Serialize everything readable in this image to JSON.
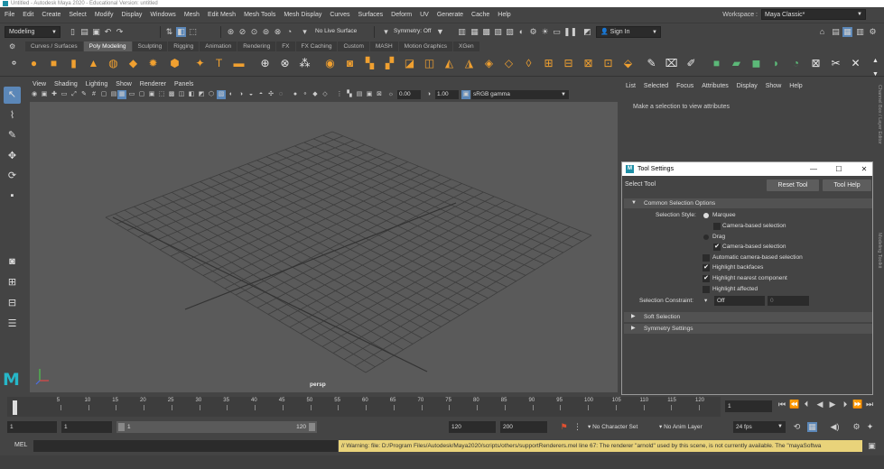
{
  "window": {
    "title": "Untitled - Autodesk Maya 2020 - Educational Version: untitled"
  },
  "menubar": {
    "items": [
      "File",
      "Edit",
      "Create",
      "Select",
      "Modify",
      "Display",
      "Windows",
      "Mesh",
      "Edit Mesh",
      "Mesh Tools",
      "Mesh Display",
      "Curves",
      "Surfaces",
      "Deform",
      "UV",
      "Generate",
      "Cache",
      "Help"
    ],
    "workspace_label": "Workspace :",
    "workspace_value": "Maya Classic*"
  },
  "statusline": {
    "mode": "Modeling",
    "live_surface": "No Live Surface",
    "symmetry": "Symmetry: Off",
    "sign_in": "Sign In"
  },
  "shelf_tabs": [
    "Curves / Surfaces",
    "Poly Modeling",
    "Sculpting",
    "Rigging",
    "Animation",
    "Rendering",
    "FX",
    "FX Caching",
    "Custom",
    "MASH",
    "Motion Graphics",
    "XGen"
  ],
  "shelf_active": "Poly Modeling",
  "viewport": {
    "menu": [
      "View",
      "Shading",
      "Lighting",
      "Show",
      "Renderer",
      "Panels"
    ],
    "exposure": "0.00",
    "gamma": "1.00",
    "color_space": "sRGB gamma",
    "camera_label": "persp"
  },
  "attribute_editor": {
    "menu": [
      "List",
      "Selected",
      "Focus",
      "Attributes",
      "Display",
      "Show",
      "Help"
    ],
    "message": "Make a selection to view attributes"
  },
  "right_strip": {
    "channel_box": "Channel Box / Layer Editor",
    "modeling_toolkit": "Modeling Toolkit"
  },
  "tool_settings": {
    "title": "Tool Settings",
    "tool_name": "Select Tool",
    "reset_button": "Reset Tool",
    "help_button": "Tool Help",
    "common_section": "Common Selection Options",
    "selection_style_label": "Selection Style:",
    "marquee": "Marquee",
    "camera_based_1": "Camera-based selection",
    "drag": "Drag",
    "camera_based_2": "Camera-based selection",
    "auto_camera": "Automatic camera-based selection",
    "highlight_backfaces": "Highlight backfaces",
    "highlight_nearest": "Highlight nearest component",
    "highlight_affected": "Highlight affected",
    "constraint_label": "Selection Constraint:",
    "constraint_value": "Off",
    "constraint_num": "0",
    "soft_selection": "Soft Selection",
    "symmetry_settings": "Symmetry Settings",
    "checks": {
      "camera_based_1": false,
      "camera_based_2": true,
      "auto_camera": false,
      "highlight_backfaces": true,
      "highlight_nearest": true,
      "highlight_affected": false
    }
  },
  "timeslider": {
    "ticks": [
      "5",
      "10",
      "15",
      "20",
      "25",
      "30",
      "35",
      "40",
      "45",
      "50",
      "55",
      "60",
      "65",
      "70",
      "75",
      "80",
      "85",
      "90",
      "95",
      "100",
      "105",
      "110",
      "115",
      "120"
    ],
    "current_frame": "1"
  },
  "range": {
    "start": "1",
    "playback_start": "1",
    "slider_start": "1",
    "slider_end": "120",
    "playback_end": "120",
    "end": "200",
    "character_set": "No Character Set",
    "anim_layer": "No Anim Layer",
    "fps": "24 fps"
  },
  "cmdline": {
    "label": "MEL",
    "warning": "// Warning: file: D:/Program Files/Autodesk/Maya2020/scripts/others/supportRenderers.mel line 67: The renderer \"arnold\" used by this scene, is not currently available. The \"mayaSoftwa"
  },
  "colors": {
    "accent": "#5b87b8",
    "shelf_orange": "#f0a030",
    "shelf_green": "#5cb878",
    "warning_bg": "#e9d37a",
    "maya_teal": "#26b7c8"
  }
}
